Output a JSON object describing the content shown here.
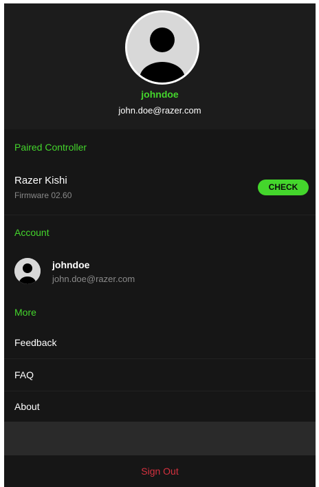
{
  "profile": {
    "username": "johndoe",
    "email": "john.doe@razer.com",
    "avatar_icon": "default-user-avatar"
  },
  "paired_controller": {
    "section_title": "Paired Controller",
    "device_name": "Razer Kishi",
    "firmware": "Firmware 02.60",
    "check_label": "CHECK"
  },
  "account": {
    "section_title": "Account",
    "username": "johndoe",
    "email": "john.doe@razer.com",
    "avatar_icon": "default-user-avatar"
  },
  "more": {
    "section_title": "More",
    "items": [
      {
        "label": "Feedback"
      },
      {
        "label": "FAQ"
      },
      {
        "label": "About"
      }
    ]
  },
  "sign_out": {
    "label": "Sign Out"
  },
  "colors": {
    "accent": "#44d62c",
    "danger": "#d5313f",
    "background": "#161616",
    "header_background": "#1c1c1c"
  }
}
